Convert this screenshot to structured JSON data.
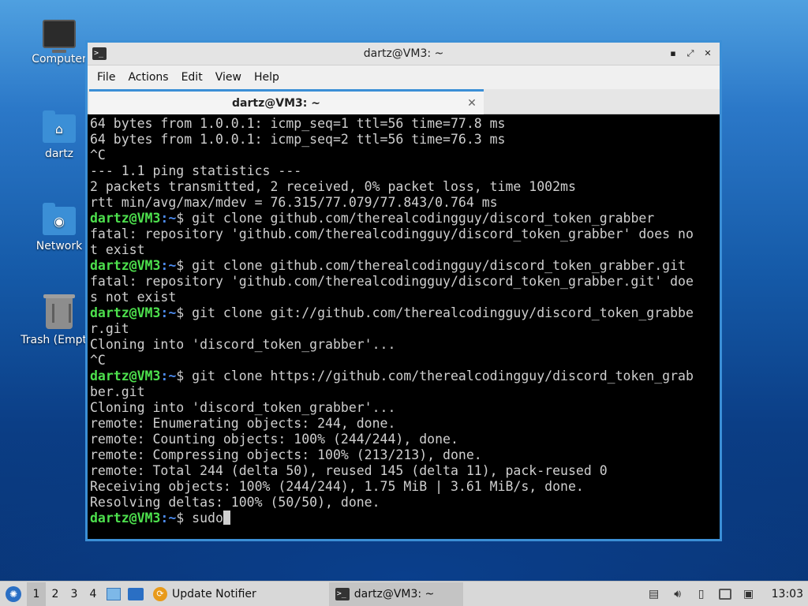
{
  "desktop": {
    "icons": [
      {
        "label": "Computer"
      },
      {
        "label": "dartz"
      },
      {
        "label": "Network"
      },
      {
        "label": "Trash (Empty)"
      }
    ]
  },
  "window": {
    "title": "dartz@VM3: ~",
    "menu": [
      "File",
      "Actions",
      "Edit",
      "View",
      "Help"
    ],
    "tab_label": "dartz@VM3: ~",
    "controls": {
      "minimize": "▪",
      "maximize": "⤢",
      "close": "✕"
    }
  },
  "terminal": {
    "prompt_user": "dartz@VM3",
    "prompt_path": ":~",
    "lines": [
      {
        "text": "64 bytes from 1.0.0.1: icmp_seq=1 ttl=56 time=77.8 ms"
      },
      {
        "text": "64 bytes from 1.0.0.1: icmp_seq=2 ttl=56 time=76.3 ms"
      },
      {
        "text": "^C"
      },
      {
        "text": "--- 1.1 ping statistics ---"
      },
      {
        "text": "2 packets transmitted, 2 received, 0% packet loss, time 1002ms"
      },
      {
        "text": "rtt min/avg/max/mdev = 76.315/77.079/77.843/0.764 ms"
      },
      {
        "prompt": true,
        "text": "$ git clone github.com/therealcodingguy/discord_token_grabber"
      },
      {
        "text": "fatal: repository 'github.com/therealcodingguy/discord_token_grabber' does no"
      },
      {
        "text": "t exist"
      },
      {
        "prompt": true,
        "text": "$ git clone github.com/therealcodingguy/discord_token_grabber.git"
      },
      {
        "text": "fatal: repository 'github.com/therealcodingguy/discord_token_grabber.git' doe"
      },
      {
        "text": "s not exist"
      },
      {
        "prompt": true,
        "text": "$ git clone git://github.com/therealcodingguy/discord_token_grabbe"
      },
      {
        "text": "r.git"
      },
      {
        "text": "Cloning into 'discord_token_grabber'..."
      },
      {
        "text": "^C"
      },
      {
        "prompt": true,
        "text": "$ git clone https://github.com/therealcodingguy/discord_token_grab"
      },
      {
        "text": "ber.git"
      },
      {
        "text": "Cloning into 'discord_token_grabber'..."
      },
      {
        "text": "remote: Enumerating objects: 244, done."
      },
      {
        "text": "remote: Counting objects: 100% (244/244), done."
      },
      {
        "text": "remote: Compressing objects: 100% (213/213), done."
      },
      {
        "text": "remote: Total 244 (delta 50), reused 145 (delta 11), pack-reused 0"
      },
      {
        "text": "Receiving objects: 100% (244/244), 1.75 MiB | 3.61 MiB/s, done."
      },
      {
        "text": "Resolving deltas: 100% (50/50), done."
      },
      {
        "prompt": true,
        "text": "$ sudo",
        "cursor": true
      }
    ]
  },
  "taskbar": {
    "workspaces": [
      "1",
      "2",
      "3",
      "4"
    ],
    "active_workspace": "1",
    "tasks": [
      {
        "label": "Update Notifier"
      },
      {
        "label": "dartz@VM3: ~"
      }
    ],
    "clock": "13:03"
  },
  "colors": {
    "accent": "#3b8fd6",
    "prompt_user": "#4de04d",
    "prompt_path": "#4d8cf0",
    "terminal_bg": "#000000",
    "terminal_fg": "#cfcfcf"
  }
}
